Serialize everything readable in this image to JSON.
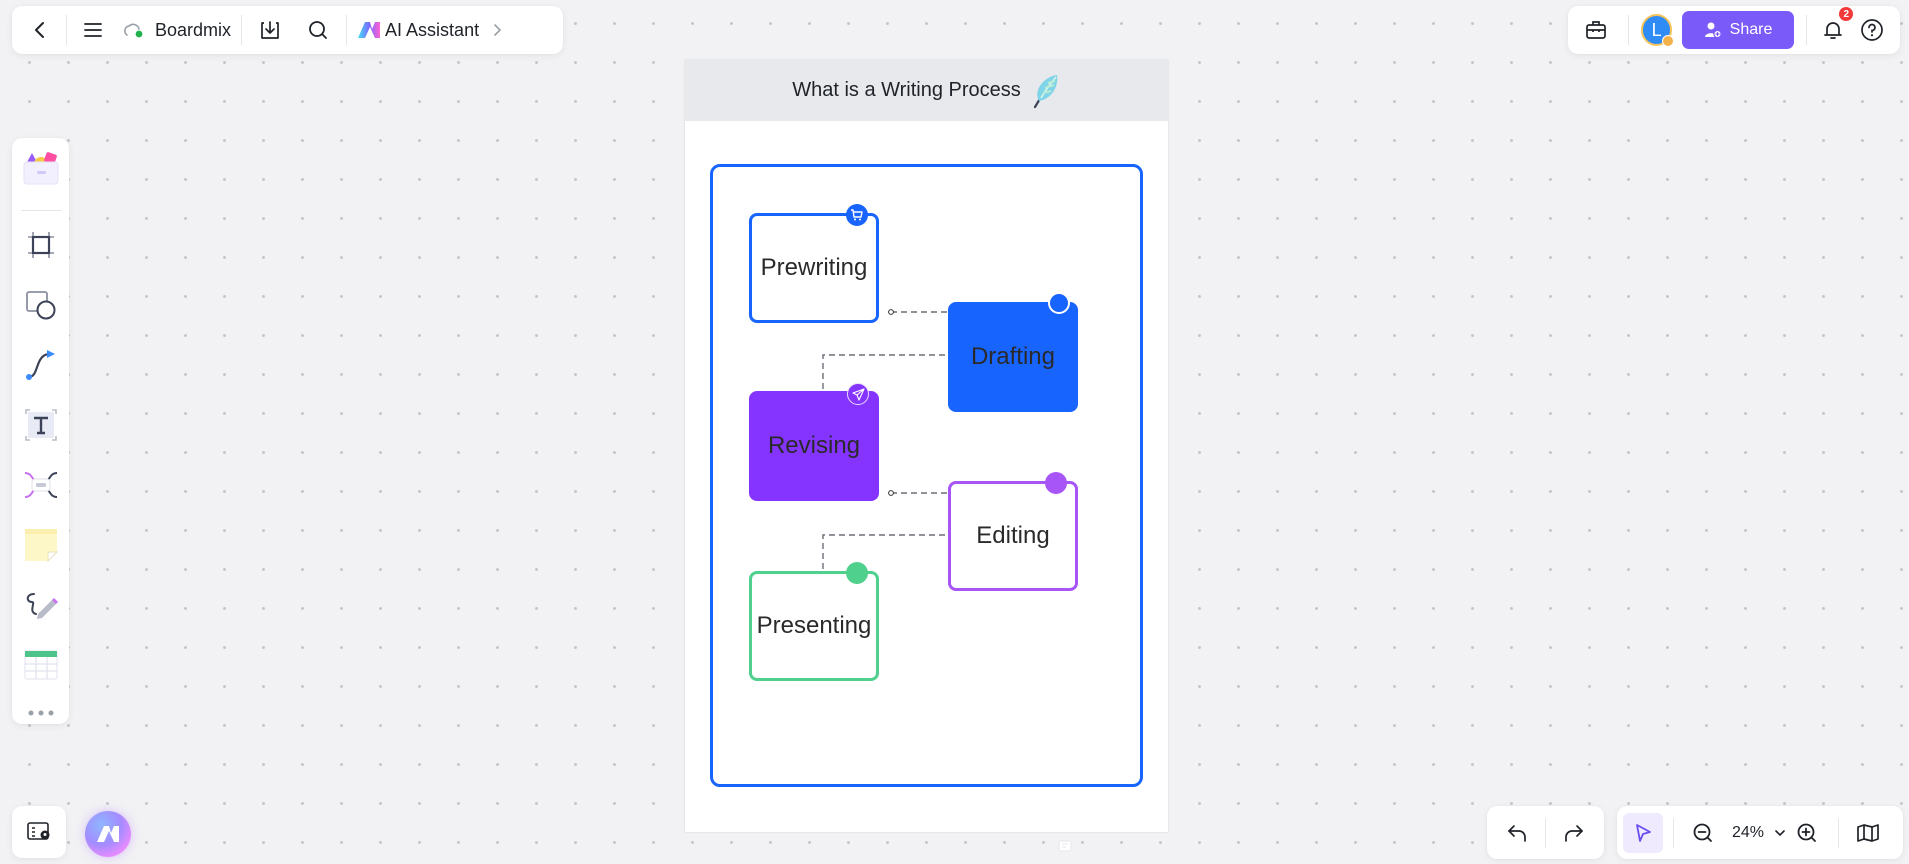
{
  "app": {
    "name": "Boardmix",
    "ai_assistant_label": "AI Assistant"
  },
  "topbar_right": {
    "avatar_initial": "L",
    "share_label": "Share",
    "notification_count": "2"
  },
  "frame": {
    "title": "What is a Writing Process"
  },
  "nodes": [
    {
      "label": "Prewriting",
      "style": "outlined",
      "color": "#1764ff",
      "pin_icon": "shopping-cart-icon"
    },
    {
      "label": "Drafting",
      "style": "filled",
      "color": "#1764ff",
      "pin_icon": "circle-icon"
    },
    {
      "label": "Revising",
      "style": "filled",
      "color": "#8534ff",
      "pin_icon": "send-icon"
    },
    {
      "label": "Editing",
      "style": "outlined",
      "color": "#a855f7",
      "pin_icon": "circle-icon"
    },
    {
      "label": "Presenting",
      "style": "outlined",
      "color": "#4fd08d",
      "pin_icon": "circle-icon"
    }
  ],
  "zoom": {
    "level": "24%"
  },
  "colors": {
    "accent": "#7a5af8",
    "frame_border": "#1764ff",
    "badge": "#f23a3a"
  }
}
